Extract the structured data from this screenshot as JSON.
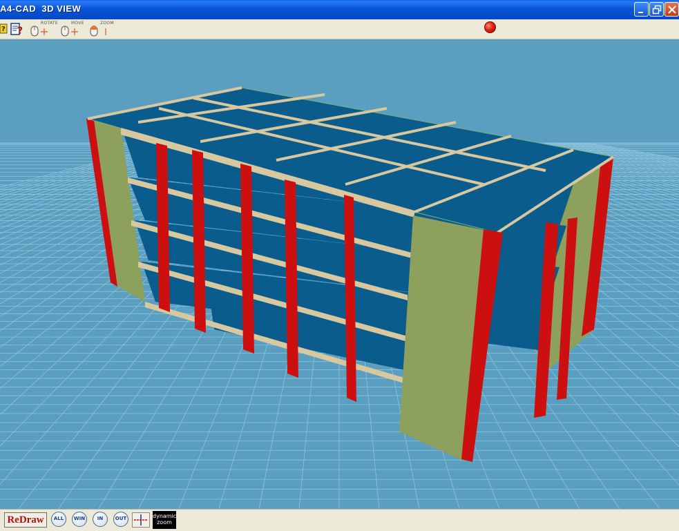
{
  "window": {
    "title": "A4-CAD  3D VIEW",
    "buttons": {
      "minimize": "minimize-icon",
      "restore": "restore-icon",
      "close": "close-icon"
    }
  },
  "toolbar": {
    "help_icon": "help-cursor-icon",
    "query_icon": "query-icon",
    "mouse_modes": [
      {
        "caption": "ROTATE",
        "icon": "rotate-mouse-icon"
      },
      {
        "caption": "MOVE",
        "icon": "move-mouse-icon"
      },
      {
        "caption": "ZOOM",
        "icon": "zoom-mouse-icon"
      }
    ],
    "stop_icon": "stop-icon"
  },
  "viewport": {
    "background": "#5a9ec0",
    "grid_color": "#8fc4dc",
    "colors": {
      "slab": "#0a5c8c",
      "beam": "#d8c8a0",
      "column": "#cc1010",
      "shear_wall": "#8da05c"
    }
  },
  "bottom": {
    "redraw_label": "ReDraw",
    "buttons": [
      {
        "label": "ALL"
      },
      {
        "label": "WIN"
      },
      {
        "label": "IN"
      },
      {
        "label": "OUT"
      }
    ],
    "pan_icon": "crosshair-icon",
    "dynamic_line1": "dynamic",
    "dynamic_line2": "zoom"
  }
}
